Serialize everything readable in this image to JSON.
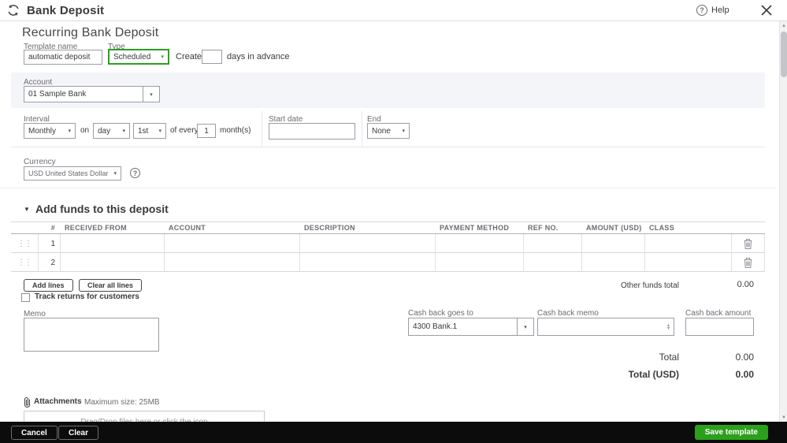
{
  "header": {
    "title": "Bank Deposit",
    "help_label": "Help"
  },
  "recurring": {
    "heading": "Recurring Bank Deposit",
    "template_name_label": "Template name",
    "template_name_value": "automatic deposit",
    "type_label": "Type",
    "type_value": "Scheduled",
    "create_label": "Create",
    "days_in_advance_value": "",
    "days_in_advance_label": "days in advance"
  },
  "account": {
    "label": "Account",
    "value": "01 Sample Bank"
  },
  "schedule": {
    "interval_label": "Interval",
    "interval_value": "Monthly",
    "on_label": "on",
    "day_unit_value": "day",
    "day_ordinal_value": "1st",
    "of_every_label": "of every",
    "every_value": "1",
    "months_label": "month(s)",
    "start_date_label": "Start date",
    "start_date_value": "",
    "end_label": "End",
    "end_value": "None"
  },
  "currency": {
    "label": "Currency",
    "value": "USD United States Dollar"
  },
  "funds": {
    "heading": "Add funds to this deposit",
    "columns": [
      "#",
      "RECEIVED FROM",
      "ACCOUNT",
      "DESCRIPTION",
      "PAYMENT METHOD",
      "REF NO.",
      "AMOUNT (USD)",
      "CLASS"
    ],
    "rows": [
      {
        "num": "1"
      },
      {
        "num": "2"
      }
    ],
    "add_lines_label": "Add lines",
    "clear_all_lines_label": "Clear all lines",
    "other_funds_total_label": "Other funds total",
    "other_funds_total_value": "0.00",
    "track_returns_label": "Track returns for customers",
    "memo_label": "Memo",
    "memo_value": ""
  },
  "cash_back": {
    "goes_to_label": "Cash back goes to",
    "goes_to_value": "4300 Bank.1",
    "memo_label": "Cash back memo",
    "memo_value": "",
    "amount_label": "Cash back amount",
    "amount_value": ""
  },
  "totals": {
    "total_label": "Total",
    "total_value": "0.00",
    "total_usd_label": "Total (USD)",
    "total_usd_value": "0.00"
  },
  "attachments": {
    "label": "Attachments",
    "max_size_label": "Maximum size: 25MB",
    "dropzone_text": "Drag/Drop files here or click the icon"
  },
  "footer": {
    "cancel_label": "Cancel",
    "clear_label": "Clear",
    "save_label": "Save template"
  },
  "icons": {
    "dropdown_caret": "▾",
    "collapse_triangle": "▼",
    "drag_handle": "⋮⋮",
    "spinner_up": "▴",
    "spinner_down": "▾",
    "scroll_up": "▲",
    "scroll_down": "▼",
    "help_mark": "?",
    "info_mark": "?"
  },
  "colors": {
    "accent_green": "#2ca01c",
    "footer_bg": "#0c0c0d"
  }
}
